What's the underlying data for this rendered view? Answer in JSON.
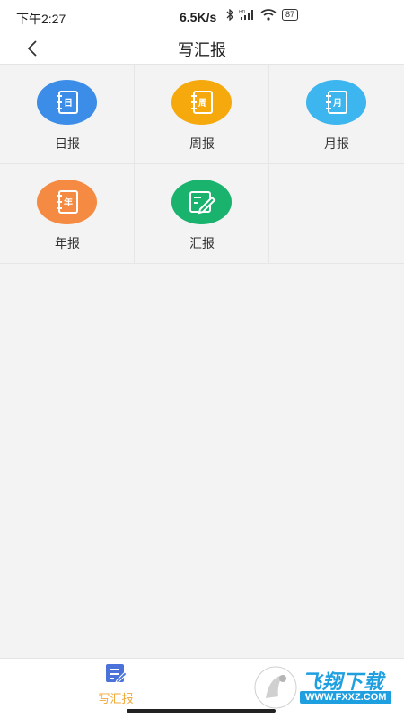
{
  "status_bar": {
    "time": "下午2:27",
    "speed": "6.5K/s",
    "battery": "87"
  },
  "nav": {
    "title": "写汇报",
    "back_icon": "chevron-left-icon"
  },
  "grid": {
    "items": [
      {
        "label": "日报",
        "icon_char": "日",
        "color": "#3c8de8"
      },
      {
        "label": "周报",
        "icon_char": "周",
        "color": "#f5a90d"
      },
      {
        "label": "月报",
        "icon_char": "月",
        "color": "#3db5ee"
      },
      {
        "label": "年报",
        "icon_char": "年",
        "color": "#f58b42"
      },
      {
        "label": "汇报",
        "icon_char": "",
        "color": "#1ab36e"
      }
    ]
  },
  "tab_bar": {
    "write_report_label": "写汇报",
    "active_color": "#f0a93a"
  },
  "watermark": {
    "text": "飞翔下载",
    "url": "WWW.FXXZ.COM"
  }
}
